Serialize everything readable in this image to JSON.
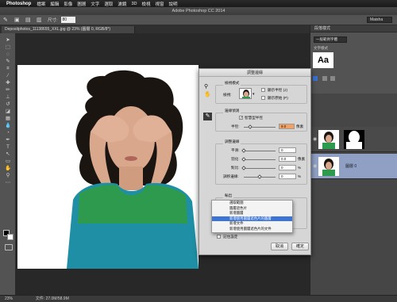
{
  "menubar": {
    "app_name": "Photoshop",
    "items": [
      "檔案",
      "編輯",
      "影像",
      "圖層",
      "文字",
      "選取",
      "濾鏡",
      "3D",
      "檢視",
      "視窗",
      "說明"
    ]
  },
  "window_title": "Adobe Photoshop CC 2014",
  "options_bar": {
    "size_label": "尺寸:",
    "size_value": "80",
    "workspace": "Maisha"
  },
  "document_tab": "Depositphotos_11138655_XXL.jpg @ 23% (圖層 0, RGB/8*)",
  "status_bar": {
    "zoom": "23%",
    "doc_info": "文件: 27.0M/58.9M"
  },
  "character_panel": {
    "tab": "段落樣式",
    "style_select": "一般範例字體",
    "font_label": "文字樣式",
    "preview_text": "Aa"
  },
  "layers": [
    {
      "name": ""
    },
    {
      "name": "圖層 0"
    }
  ],
  "dialog": {
    "title": "調整邊緣",
    "view_mode_header": "檢視模式",
    "view_label": "檢視:",
    "show_radius": "顯示半徑 (J)",
    "show_original": "顯示原始 (P)",
    "edge_detection_header": "邊緣偵測",
    "smart_radius": "智慧型半徑",
    "radius_label": "半徑:",
    "radius_value": "9.0",
    "radius_unit": "像素",
    "adjust_edge_header": "調整邊緣",
    "smooth_label": "平滑:",
    "smooth_value": "0",
    "feather_label": "羽化:",
    "feather_value": "0.0",
    "feather_unit": "像素",
    "contrast_label": "對比:",
    "contrast_value": "0",
    "contrast_unit": "%",
    "shift_edge_label": "調移邊緣:",
    "shift_edge_value": "0",
    "shift_edge_unit": "%",
    "output_header": "輸出",
    "decontaminate_label": "淨化",
    "amount_label": "總量",
    "output_to_label": "輸出到:",
    "remember_settings": "記住設定",
    "cancel": "取消",
    "ok": "確定",
    "smooth_pct": 0,
    "feather_pct": 0,
    "contrast_pct": 0,
    "shift_pct": 50
  },
  "output_menu": {
    "items": [
      "選取範圍",
      "圖層遮色片",
      "新增圖層",
      "新增使用圖層遮色片的圖層",
      "新增文件",
      "新增使用圖層遮色片的文件"
    ],
    "selected_index": 3
  }
}
